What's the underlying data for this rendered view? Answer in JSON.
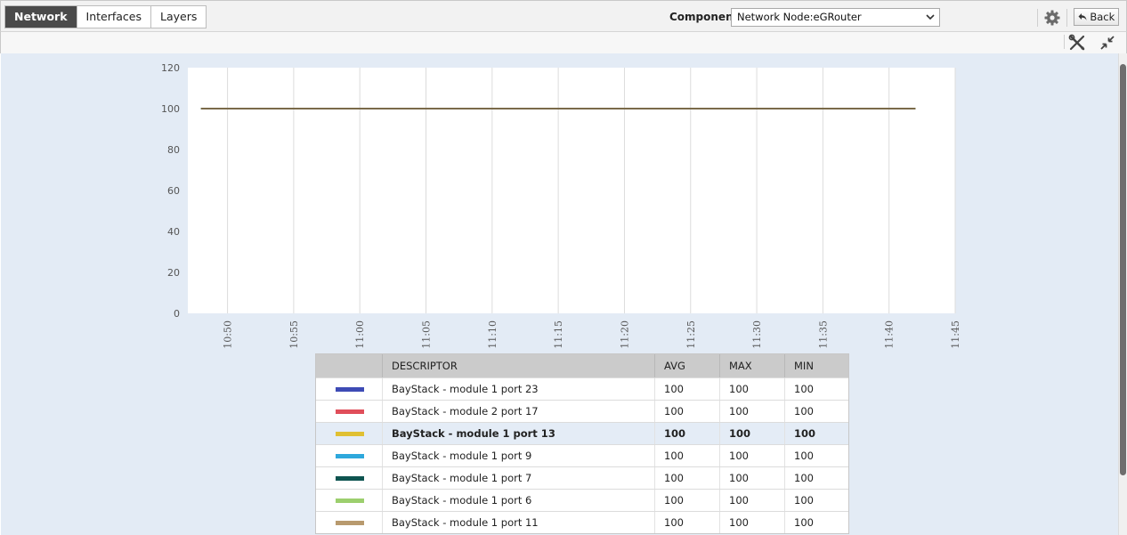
{
  "tabs": [
    {
      "label": "Network",
      "active": true
    },
    {
      "label": "Interfaces",
      "active": false
    },
    {
      "label": "Layers",
      "active": false
    }
  ],
  "component": {
    "label": "Component",
    "selected": "Network Node:eGRouter"
  },
  "header": {
    "back_label": "Back",
    "settings_icon": "gear-icon",
    "back_icon": "back-arrow-icon"
  },
  "toolbar": {
    "tools_icon": "tools-icon",
    "collapse_icon": "collapse-icon"
  },
  "chart_data": {
    "type": "line",
    "title": "",
    "xlabel": "",
    "ylabel": "",
    "ylim": [
      0,
      120
    ],
    "yticks": [
      "0",
      "20",
      "40",
      "60",
      "80",
      "100",
      "120"
    ],
    "xticks": [
      "10:50",
      "10:55",
      "11:00",
      "11:05",
      "11:10",
      "11:15",
      "11:20",
      "11:25",
      "11:30",
      "11:35",
      "11:40",
      "11:45"
    ],
    "xlim": [
      "10:47",
      "11:45"
    ],
    "grid": true,
    "series": [
      {
        "name": "BayStack - module 1 port 23",
        "color": "#3e4bb5",
        "x": [
          "10:48",
          "11:42"
        ],
        "values": [
          100,
          100
        ]
      },
      {
        "name": "BayStack - module 2 port 17",
        "color": "#e04e5a",
        "x": [
          "10:48",
          "11:42"
        ],
        "values": [
          100,
          100
        ]
      },
      {
        "name": "BayStack - module 1 port 13",
        "color": "#e0c032",
        "x": [
          "10:48",
          "11:42"
        ],
        "values": [
          100,
          100
        ]
      },
      {
        "name": "BayStack - module 1 port 9",
        "color": "#2ea8dc",
        "x": [
          "10:48",
          "11:42"
        ],
        "values": [
          100,
          100
        ]
      },
      {
        "name": "BayStack - module 1 port 7",
        "color": "#0e5450",
        "x": [
          "10:48",
          "11:42"
        ],
        "values": [
          100,
          100
        ]
      },
      {
        "name": "BayStack - module 1 port 6",
        "color": "#9ccf6e",
        "x": [
          "10:48",
          "11:42"
        ],
        "values": [
          100,
          100
        ]
      },
      {
        "name": "BayStack - module 1 port 11",
        "color": "#7a6a4a",
        "x": [
          "10:48",
          "11:42"
        ],
        "values": [
          100,
          100
        ]
      }
    ]
  },
  "table": {
    "columns": [
      "",
      "DESCRIPTOR",
      "AVG",
      "MAX",
      "MIN"
    ],
    "rows": [
      {
        "color": "#3e4bb5",
        "descriptor": "BayStack - module 1 port 23",
        "avg": "100",
        "max": "100",
        "min": "100",
        "selected": false
      },
      {
        "color": "#e04e5a",
        "descriptor": "BayStack - module 2 port 17",
        "avg": "100",
        "max": "100",
        "min": "100",
        "selected": false
      },
      {
        "color": "#e0c032",
        "descriptor": "BayStack - module 1 port 13",
        "avg": "100",
        "max": "100",
        "min": "100",
        "selected": true
      },
      {
        "color": "#2ea8dc",
        "descriptor": "BayStack - module 1 port 9",
        "avg": "100",
        "max": "100",
        "min": "100",
        "selected": false
      },
      {
        "color": "#0e5450",
        "descriptor": "BayStack - module 1 port 7",
        "avg": "100",
        "max": "100",
        "min": "100",
        "selected": false
      },
      {
        "color": "#9ccf6e",
        "descriptor": "BayStack - module 1 port 6",
        "avg": "100",
        "max": "100",
        "min": "100",
        "selected": false
      },
      {
        "color": "#b89a6e",
        "descriptor": "BayStack - module 1 port 11",
        "avg": "100",
        "max": "100",
        "min": "100",
        "selected": false
      }
    ]
  }
}
